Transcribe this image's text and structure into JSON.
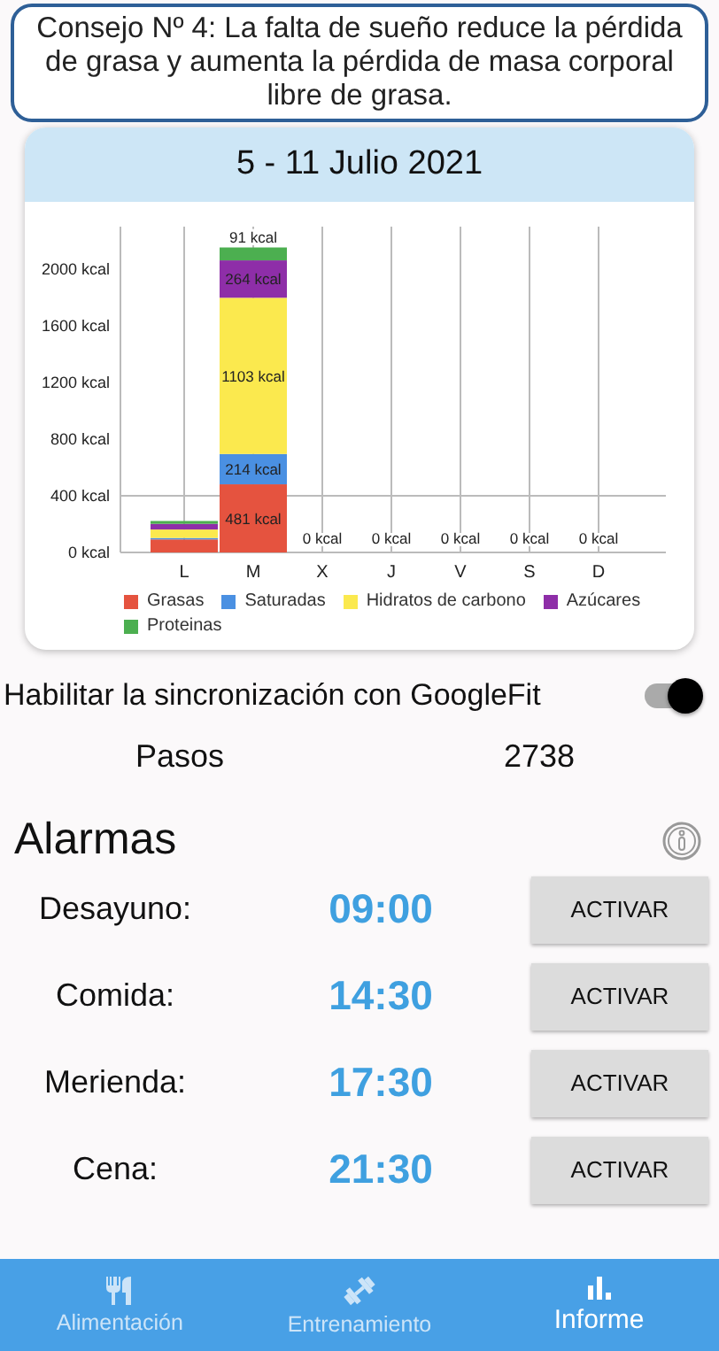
{
  "tip": "Consejo Nº 4: La falta de sueño reduce la pérdida de grasa y aumenta la pérdida de masa corporal libre de grasa.",
  "report": {
    "title": "5 - 11 Julio 2021",
    "chart_data": {
      "type": "bar",
      "stacked": true,
      "categories": [
        "L",
        "M",
        "X",
        "J",
        "V",
        "S",
        "D"
      ],
      "series": [
        {
          "name": "Grasas",
          "color": "#e5533f",
          "values": [
            92,
            481,
            0,
            0,
            0,
            0,
            0
          ]
        },
        {
          "name": "Saturadas",
          "color": "#4a90e2",
          "values": [
            10,
            214,
            0,
            0,
            0,
            0,
            0
          ]
        },
        {
          "name": "Hidratos de carbono",
          "color": "#fbe94e",
          "values": [
            60,
            1103,
            0,
            0,
            0,
            0,
            0
          ]
        },
        {
          "name": "Azúcares",
          "color": "#8e2ea8",
          "values": [
            40,
            264,
            0,
            0,
            0,
            0,
            0
          ]
        },
        {
          "name": "Proteinas",
          "color": "#4caf50",
          "values": [
            20,
            91,
            0,
            0,
            0,
            0,
            0
          ]
        }
      ],
      "ylim": [
        0,
        2300
      ],
      "grid": true,
      "yticks": [
        {
          "value": 0,
          "label": "0 kcal"
        },
        {
          "value": 400,
          "label": "400 kcal"
        },
        {
          "value": 800,
          "label": "800 kcal"
        },
        {
          "value": 1200,
          "label": "1200 kcal"
        },
        {
          "value": 1600,
          "label": "1600 kcal"
        },
        {
          "value": 2000,
          "label": "2000 kcal"
        }
      ],
      "value_labels": [
        null,
        [
          "481 kcal",
          "214 kcal",
          "1103 kcal",
          "264 kcal",
          "91 kcal"
        ],
        [
          "0 kcal"
        ],
        [
          "0 kcal"
        ],
        [
          "0 kcal"
        ],
        [
          "0 kcal"
        ],
        [
          "0 kcal"
        ]
      ]
    }
  },
  "sync": {
    "label": "Habilitar la sincronización con GoogleFit",
    "on": true
  },
  "steps": {
    "label": "Pasos",
    "value": "2738"
  },
  "alarms": {
    "title": "Alarmas",
    "items": [
      {
        "label": "Desayuno:",
        "time": "09:00",
        "button": "ACTIVAR"
      },
      {
        "label": "Comida:",
        "time": "14:30",
        "button": "ACTIVAR"
      },
      {
        "label": "Merienda:",
        "time": "17:30",
        "button": "ACTIVAR"
      },
      {
        "label": "Cena:",
        "time": "21:30",
        "button": "ACTIVAR"
      }
    ]
  },
  "nav": [
    {
      "label": "Alimentación",
      "kind": "food",
      "selected": false
    },
    {
      "label": "Entrenamiento",
      "kind": "training",
      "selected": false
    },
    {
      "label": "Informe",
      "kind": "report",
      "selected": true
    }
  ]
}
